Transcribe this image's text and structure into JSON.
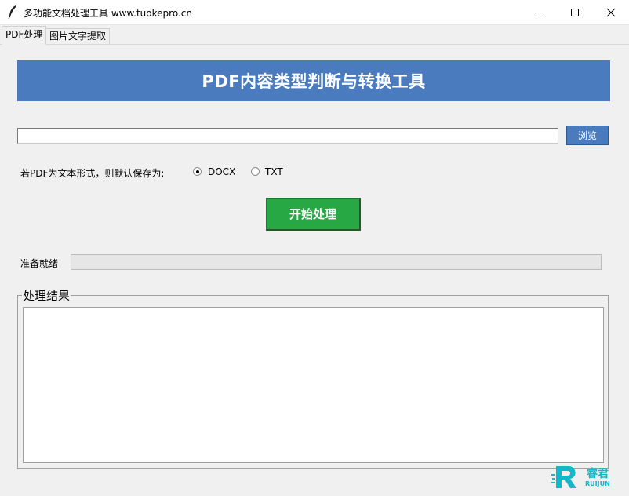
{
  "window": {
    "title": "多功能文档处理工具 www.tuokepro.cn",
    "icon": "feather-icon",
    "controls": [
      "minimize-icon",
      "maximize-icon",
      "close-icon"
    ]
  },
  "tabs": [
    {
      "label": "PDF处理",
      "active": true
    },
    {
      "label": "图片文字提取",
      "active": false
    }
  ],
  "banner": {
    "title": "PDF内容类型判断与转换工具",
    "background": "#4a7bbe"
  },
  "file": {
    "path_value": "",
    "browse_label": "浏览"
  },
  "save_format": {
    "label": "若PDF为文本形式，则默认保存为:",
    "options": [
      {
        "label": "DOCX",
        "selected": true
      },
      {
        "label": "TXT",
        "selected": false
      }
    ]
  },
  "actions": {
    "start_label": "开始处理",
    "start_color": "#28a745"
  },
  "status": {
    "text": "准备就绪",
    "progress": 0
  },
  "results": {
    "legend": "处理结果",
    "content": ""
  },
  "watermark": {
    "name": "睿君",
    "sub": "RUIJUN",
    "color": "#13b7c9"
  }
}
